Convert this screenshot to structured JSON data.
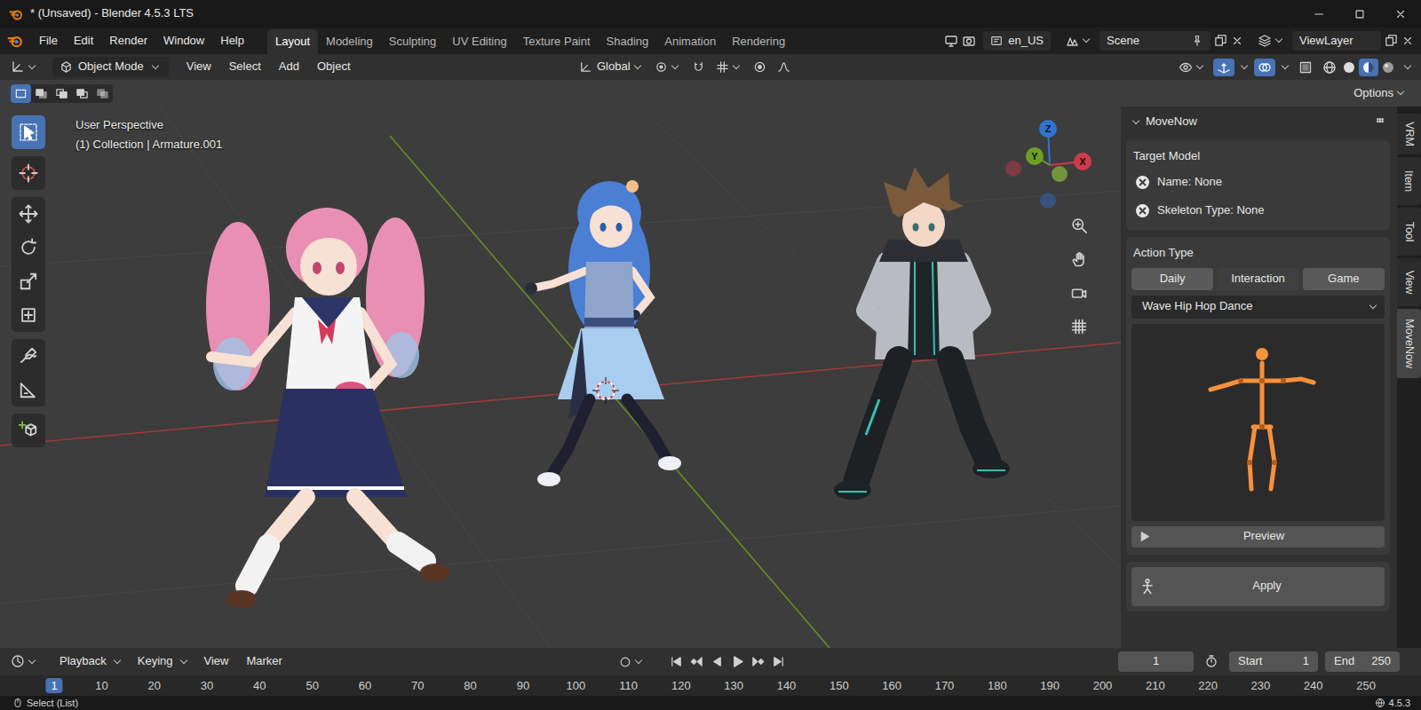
{
  "window": {
    "title": "* (Unsaved) - Blender 4.5.3 LTS"
  },
  "menu": [
    "File",
    "Edit",
    "Render",
    "Window",
    "Help"
  ],
  "workspaces": [
    {
      "label": "Layout",
      "selected": true
    },
    {
      "label": "Modeling",
      "selected": false
    },
    {
      "label": "Sculpting",
      "selected": false
    },
    {
      "label": "UV Editing",
      "selected": false
    },
    {
      "label": "Texture Paint",
      "selected": false
    },
    {
      "label": "Shading",
      "selected": false
    },
    {
      "label": "Animation",
      "selected": false
    },
    {
      "label": "Rendering",
      "selected": false
    }
  ],
  "topbar": {
    "language": "en_US",
    "scene": "Scene",
    "view_layer": "ViewLayer"
  },
  "viewport_header": {
    "mode": "Object Mode",
    "menus": [
      "View",
      "Select",
      "Add",
      "Object"
    ],
    "orientation": "Global",
    "gizmos_on": true,
    "overlays_on": true,
    "shading": [
      {
        "selected": false
      },
      {
        "selected": false
      },
      {
        "selected": true
      },
      {
        "selected": false
      }
    ]
  },
  "tool_settings": {
    "select_modes": [
      {
        "selected": true
      },
      {
        "selected": false
      },
      {
        "selected": false
      },
      {
        "selected": false
      },
      {
        "selected": false
      }
    ],
    "options": "Options"
  },
  "viewport": {
    "view_name": "User Perspective",
    "object_info": "(1) Collection | Armature.001",
    "tools": [
      {
        "selected": true
      },
      {
        "selected": false
      },
      {
        "selected": false
      },
      {
        "selected": false
      },
      {
        "selected": false
      },
      {
        "selected": false
      },
      {
        "selected": false
      },
      {
        "selected": false
      },
      {
        "selected": false
      }
    ]
  },
  "gizmo": {
    "axes": [
      {
        "label": "Z",
        "color": "#2f74d0"
      },
      {
        "label": "Y",
        "color": "#6c9f24"
      },
      {
        "label": "X",
        "color": "#d03a4a"
      }
    ],
    "negative_axes": [
      {
        "color": "#8a3a44"
      },
      {
        "color": "#7ea33a"
      },
      {
        "color": "#36558a"
      }
    ]
  },
  "sidebar": {
    "panel_title": "MoveNow",
    "expanded": true,
    "target_model": {
      "title": "Target Model",
      "fields": [
        "Name: None",
        "Skeleton Type: None"
      ]
    },
    "action_type": {
      "title": "Action Type",
      "options": [
        {
          "label": "Daily",
          "selected": true
        },
        {
          "label": "Interaction",
          "selected": false
        },
        {
          "label": "Game",
          "selected": true
        }
      ],
      "action": "Wave Hip Hop Dance",
      "preview_button": "Preview"
    },
    "apply_button": "Apply",
    "tabs": [
      {
        "label": "VRM",
        "selected": false
      },
      {
        "label": "Item",
        "selected": false
      },
      {
        "label": "Tool",
        "selected": false
      },
      {
        "label": "View",
        "selected": false
      },
      {
        "label": "MoveNow",
        "selected": true
      }
    ]
  },
  "timeline": {
    "menus": [
      {
        "label": "Playback",
        "kind": "dropdown"
      },
      {
        "label": "Keying",
        "kind": "dropdown"
      },
      {
        "label": "View",
        "kind": "menu"
      },
      {
        "label": "Marker",
        "kind": "menu"
      }
    ],
    "current_frame": "1",
    "start_label": "Start",
    "start": "1",
    "end_label": "End",
    "end": "250",
    "ticks": [
      {
        "label": "1",
        "selected": true
      },
      {
        "label": "10",
        "selected": false
      },
      {
        "label": "20",
        "selected": false
      },
      {
        "label": "30",
        "selected": false
      },
      {
        "label": "40",
        "selected": false
      },
      {
        "label": "50",
        "selected": false
      },
      {
        "label": "60",
        "selected": false
      },
      {
        "label": "70",
        "selected": false
      },
      {
        "label": "80",
        "selected": false
      },
      {
        "label": "90",
        "selected": false
      },
      {
        "label": "100",
        "selected": false
      },
      {
        "label": "110",
        "selected": false
      },
      {
        "label": "120",
        "selected": false
      },
      {
        "label": "130",
        "selected": false
      },
      {
        "label": "140",
        "selected": false
      },
      {
        "label": "150",
        "selected": false
      },
      {
        "label": "160",
        "selected": false
      },
      {
        "label": "170",
        "selected": false
      },
      {
        "label": "180",
        "selected": false
      },
      {
        "label": "190",
        "selected": false
      },
      {
        "label": "200",
        "selected": false
      },
      {
        "label": "210",
        "selected": false
      },
      {
        "label": "220",
        "selected": false
      },
      {
        "label": "230",
        "selected": false
      },
      {
        "label": "240",
        "selected": false
      },
      {
        "label": "250",
        "selected": false
      }
    ]
  },
  "status_bar": {
    "left": "Select (List)",
    "version": "4.5.3"
  }
}
